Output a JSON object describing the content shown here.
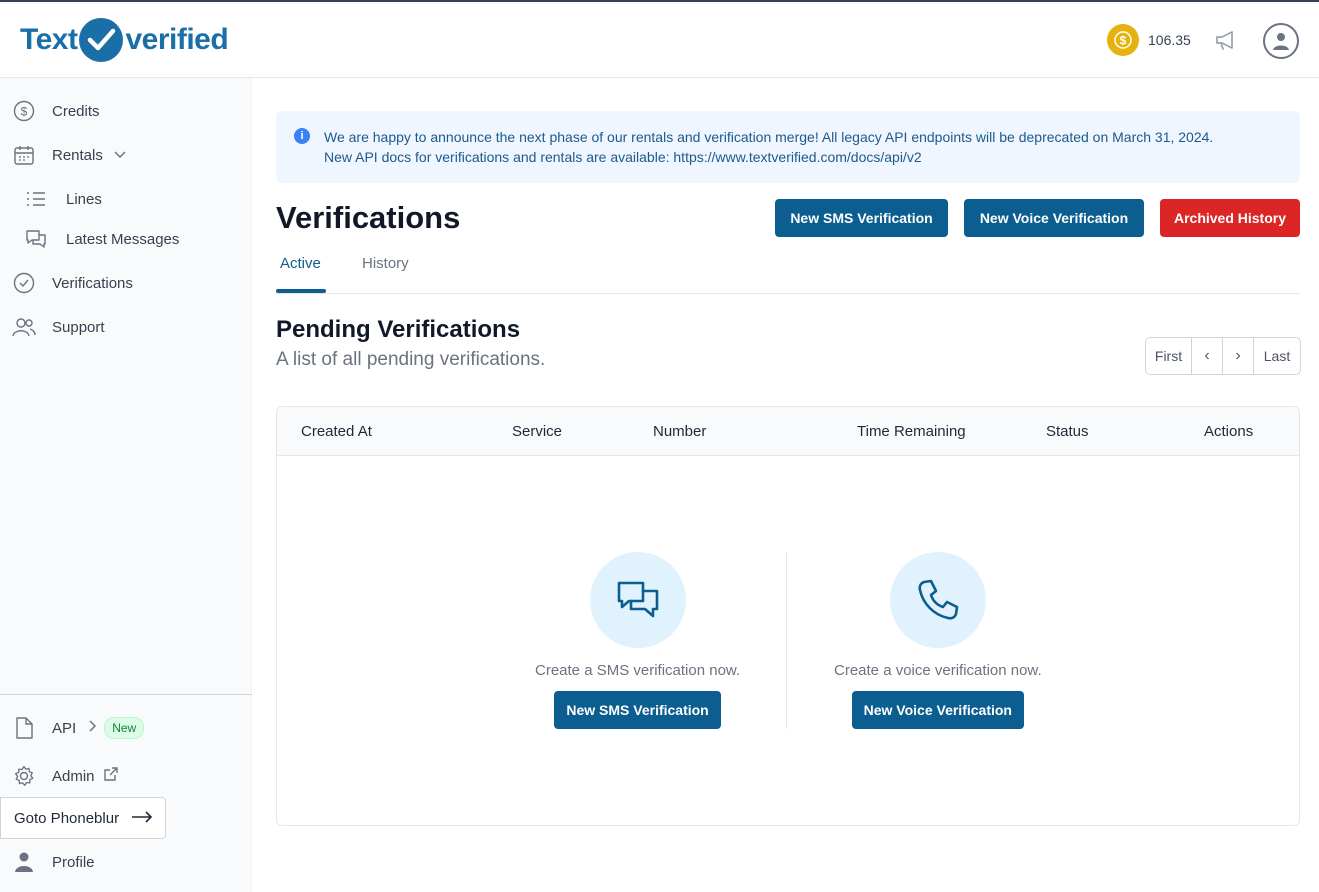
{
  "brand": {
    "logo_left": "Text",
    "logo_right": "verified",
    "accent": "#0b5e8f"
  },
  "header": {
    "credits": "106.35"
  },
  "sidebar": {
    "credits": "Credits",
    "rentals": "Rentals",
    "lines": "Lines",
    "latest_messages": "Latest Messages",
    "verifications": "Verifications",
    "support": "Support",
    "api": "API",
    "api_badge": "New",
    "admin": "Admin",
    "goto_phoneblur": "Goto Phoneblur",
    "profile": "Profile"
  },
  "alert": {
    "line1": "We are happy to announce the next phase of our rentals and verification merge! All legacy API endpoints will be deprecated on March 31, 2024.",
    "line2": "New API docs for verifications and rentals are available: https://www.textverified.com/docs/api/v2"
  },
  "page": {
    "title": "Verifications",
    "new_sms": "New SMS Verification",
    "new_voice": "New Voice Verification",
    "archived": "Archived History"
  },
  "tabs": {
    "active": "Active",
    "history": "History"
  },
  "section": {
    "title": "Pending Verifications",
    "subtitle": "A list of all pending verifications."
  },
  "pager": {
    "first": "First",
    "prev": "‹",
    "next": "›",
    "last": "Last"
  },
  "table": {
    "columns": [
      "Created At",
      "Service",
      "Number",
      "Time Remaining",
      "Status",
      "Actions"
    ]
  },
  "empty": {
    "sms_text": "Create a SMS verification now.",
    "sms_btn": "New SMS Verification",
    "voice_text": "Create a voice verification now.",
    "voice_btn": "New Voice Verification"
  }
}
